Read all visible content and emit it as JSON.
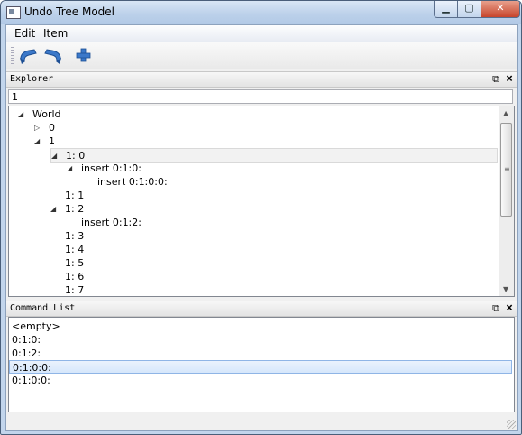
{
  "window": {
    "title": "Undo Tree Model"
  },
  "menubar": {
    "items": [
      "Edit",
      "Item"
    ]
  },
  "toolbar": {
    "buttons": [
      {
        "name": "undo-icon",
        "color": "#3b78c9"
      },
      {
        "name": "redo-icon",
        "color": "#3b78c9"
      },
      {
        "name": "add-icon",
        "color": "#3b78c9"
      }
    ]
  },
  "explorer": {
    "title": "Explorer",
    "input_value": "1",
    "tree": [
      {
        "label": "World",
        "depth": 0,
        "toggle": "expanded"
      },
      {
        "label": "0",
        "depth": 1,
        "toggle": "collapsed"
      },
      {
        "label": "1",
        "depth": 1,
        "toggle": "expanded"
      },
      {
        "label": "1: 0",
        "depth": 2,
        "toggle": "expanded",
        "selected": true
      },
      {
        "label": "insert 0:1:0:",
        "depth": 3,
        "toggle": "expanded"
      },
      {
        "label": "insert 0:1:0:0:",
        "depth": 4,
        "toggle": "none"
      },
      {
        "label": "1: 1",
        "depth": 2,
        "toggle": "none"
      },
      {
        "label": "1: 2",
        "depth": 2,
        "toggle": "expanded"
      },
      {
        "label": "insert 0:1:2:",
        "depth": 3,
        "toggle": "none"
      },
      {
        "label": "1: 3",
        "depth": 2,
        "toggle": "none"
      },
      {
        "label": "1: 4",
        "depth": 2,
        "toggle": "none"
      },
      {
        "label": "1: 5",
        "depth": 2,
        "toggle": "none"
      },
      {
        "label": "1: 6",
        "depth": 2,
        "toggle": "none"
      },
      {
        "label": "1: 7",
        "depth": 2,
        "toggle": "none"
      }
    ]
  },
  "command_list": {
    "title": "Command List",
    "items": [
      {
        "label": "<empty>",
        "selected": false
      },
      {
        "label": "0:1:0:",
        "selected": false
      },
      {
        "label": "0:1:2:",
        "selected": false
      },
      {
        "label": "0:1:0:0:",
        "selected": true
      },
      {
        "label": "0:1:0:0:",
        "selected": false
      }
    ]
  }
}
